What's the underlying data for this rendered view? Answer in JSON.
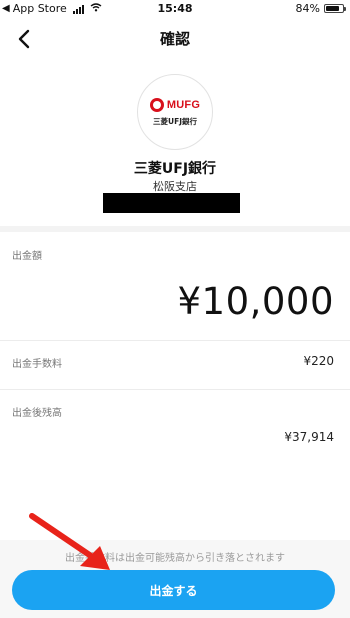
{
  "status_bar": {
    "carrier_back": "App Store",
    "time": "15:48",
    "battery_percent": "84%",
    "battery_level": 0.84
  },
  "nav": {
    "title": "確認"
  },
  "bank": {
    "logo_text": "MUFG",
    "logo_subtext": "三菱UFJ銀行",
    "name": "三菱UFJ銀行",
    "branch": "松阪支店"
  },
  "withdrawal": {
    "amount_label": "出金額",
    "amount_value": "¥10,000",
    "fee_label": "出金手数料",
    "fee_value": "¥220",
    "balance_label": "出金後残高",
    "balance_value": "¥37,914"
  },
  "footer": {
    "note": "出金手数料は出金可能残高から引き落とされます",
    "button_label": "出金する"
  },
  "colors": {
    "accent": "#1ba3f2",
    "brand_red": "#d8101c",
    "annotation_arrow": "#e8231a"
  },
  "icons": {
    "back": "chevron-left-icon",
    "wifi": "wifi-icon",
    "signal": "signal-bars-icon",
    "battery": "battery-icon"
  }
}
